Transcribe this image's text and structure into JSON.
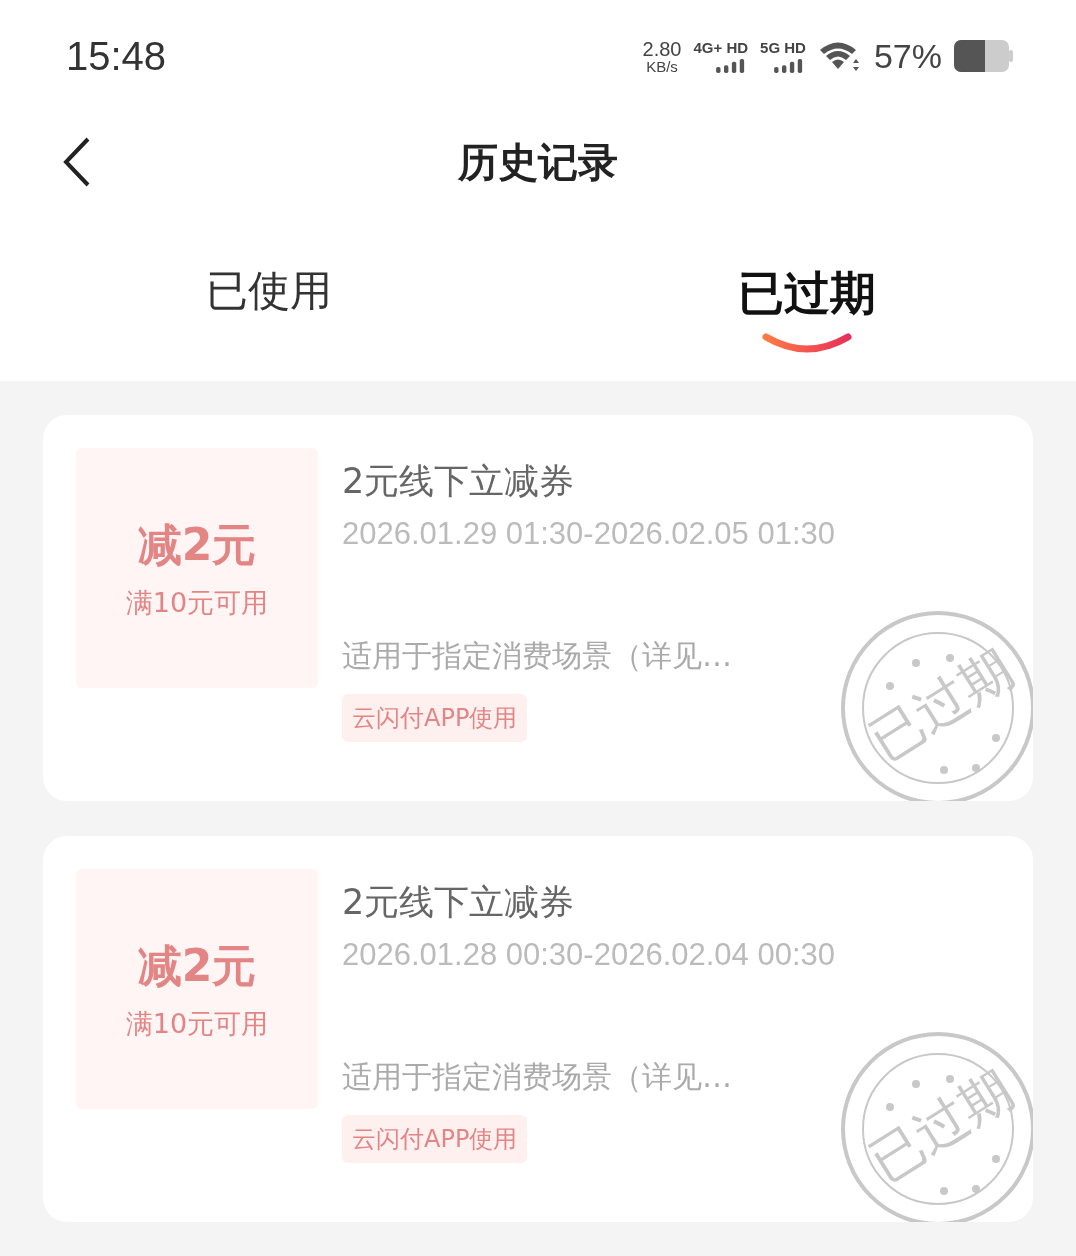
{
  "status_bar": {
    "time": "15:48",
    "speed": "2.80",
    "speed_unit": "KB/s",
    "networks": [
      "4G+ HD",
      "5G HD"
    ],
    "battery": "57%"
  },
  "header": {
    "title": "历史记录"
  },
  "tabs": [
    {
      "label": "已使用",
      "selected": false
    },
    {
      "label": "已过期",
      "selected": true
    }
  ],
  "coupons": [
    {
      "amount": "减2元",
      "condition": "满10元可用",
      "title": "2元线下立减券",
      "period": "2026.01.29 01:30-2026.02.05 01:30",
      "scope": "适用于指定消费场景（详见…",
      "tag": "云闪付APP使用",
      "stamp": "已过期"
    },
    {
      "amount": "减2元",
      "condition": "满10元可用",
      "title": "2元线下立减券",
      "period": "2026.01.28 00:30-2026.02.04 00:30",
      "scope": "适用于指定消费场景（详见…",
      "tag": "云闪付APP使用",
      "stamp": "已过期"
    }
  ]
}
